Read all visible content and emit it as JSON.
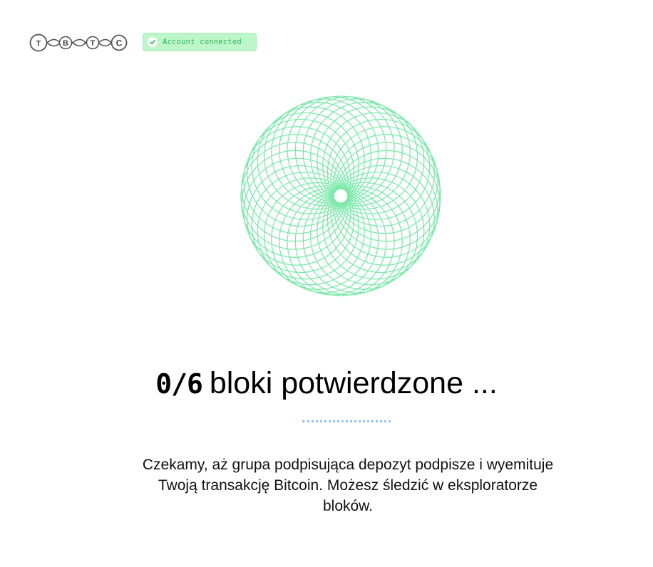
{
  "header": {
    "logo": {
      "icon": "tbtc-logo-icon",
      "letters": [
        "T",
        "B",
        "T",
        "C"
      ]
    },
    "status_badge": {
      "icon": "check-icon",
      "label": "Account connected",
      "colors": {
        "background": "#bdf7c9",
        "text": "#2fb45a"
      }
    }
  },
  "main": {
    "illustration": {
      "icon": "spirograph-icon",
      "colors": {
        "outer": "#7ee8ab",
        "inner": "#e3ccf5"
      }
    },
    "progress": {
      "confirmed_blocks": 0,
      "total_blocks": 6,
      "count_text": "0/6",
      "label": "bloki potwierdzone ..."
    },
    "description": "Czekamy, aż grupa podpisująca depozyt podpisze i wyemituje Twoją transakcję Bitcoin. Możesz śledzić w eksploratorze bloków."
  }
}
